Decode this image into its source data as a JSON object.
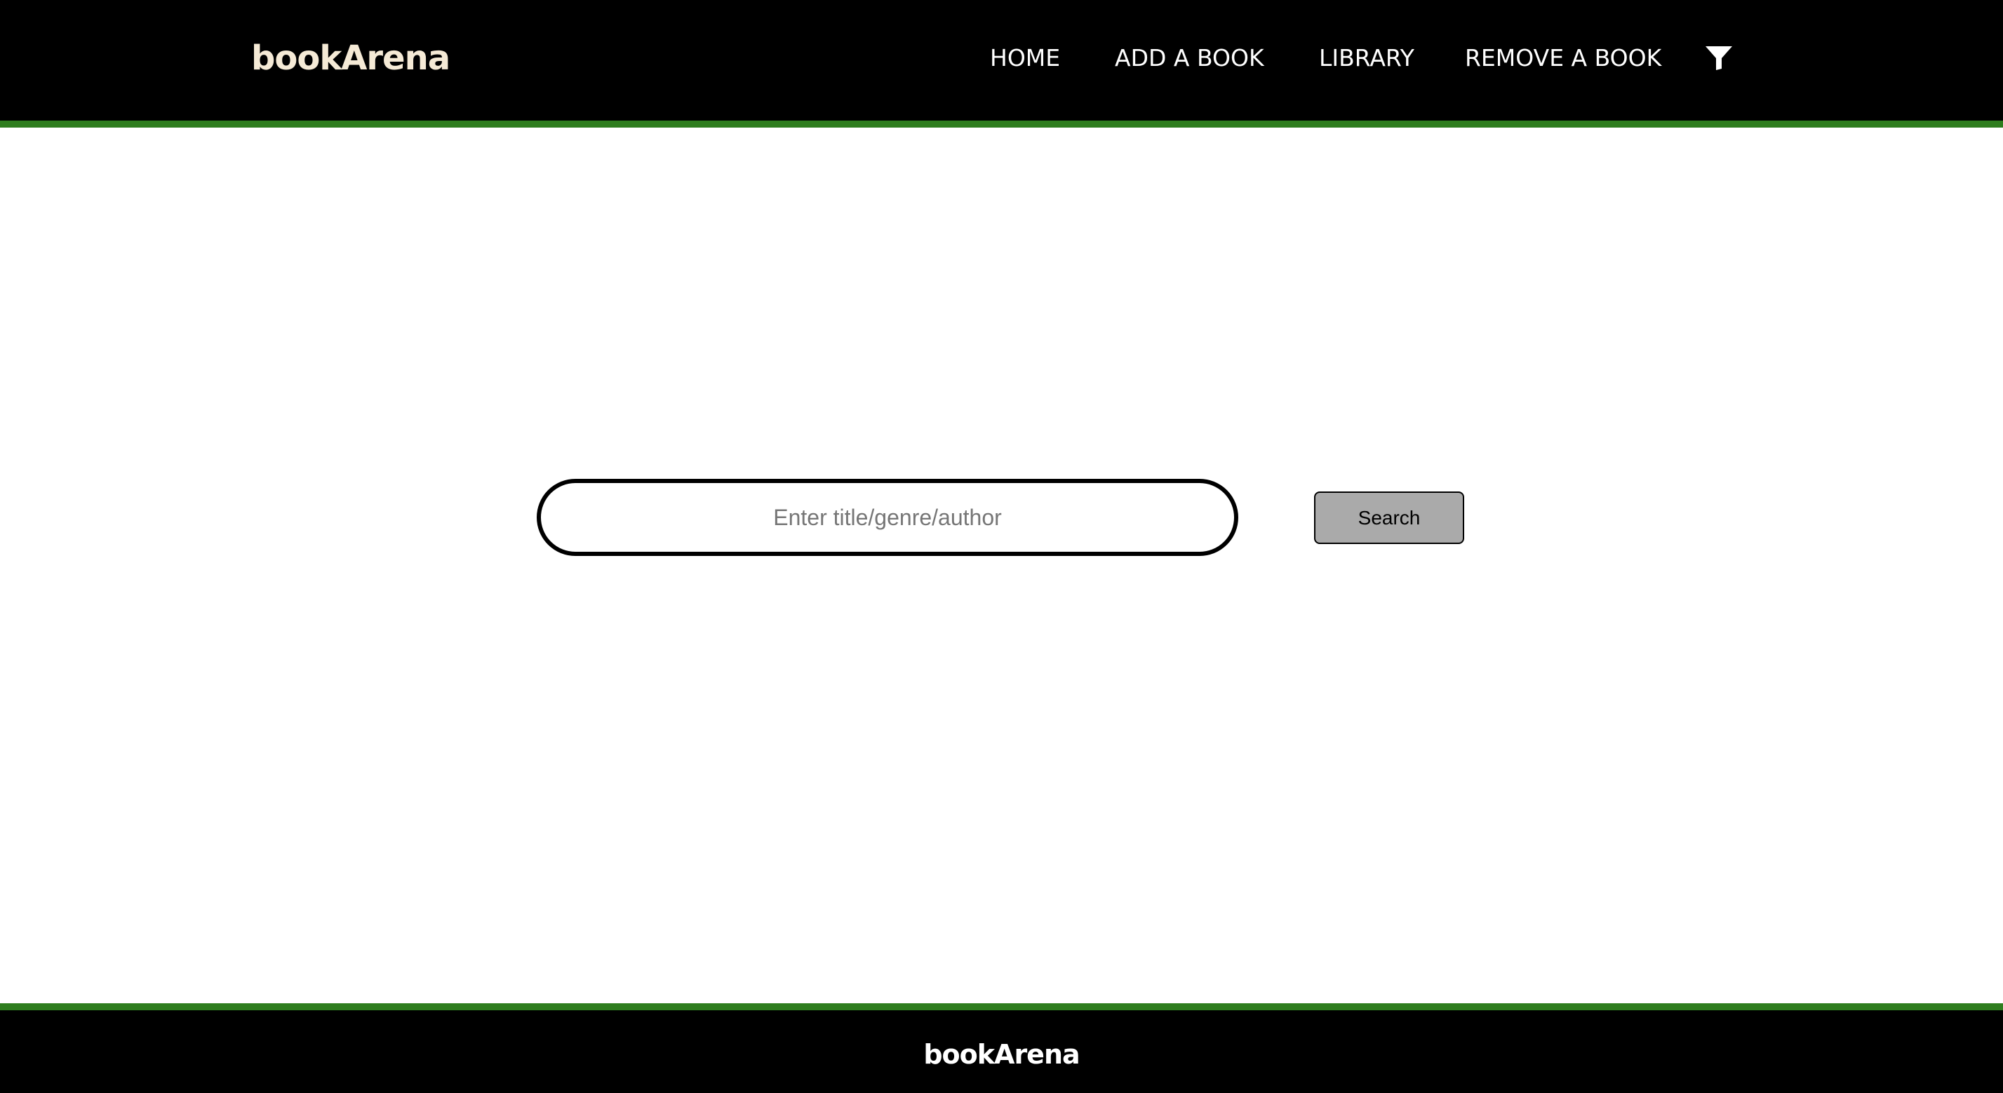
{
  "header": {
    "brand": "bookArena",
    "nav": {
      "home": "HOME",
      "add_book": "ADD A BOOK",
      "library": "LIBRARY",
      "remove_book": "REMOVE A BOOK"
    },
    "filter_icon": "filter-funnel-icon"
  },
  "search": {
    "placeholder": "Enter title/genre/author",
    "value": "",
    "button_label": "Search"
  },
  "footer": {
    "brand": "bookArena"
  },
  "colors": {
    "header_bg": "#000000",
    "accent_stripe": "#2e7d1e",
    "brand_text": "#f5ead6",
    "button_bg": "#aaaaaa"
  }
}
